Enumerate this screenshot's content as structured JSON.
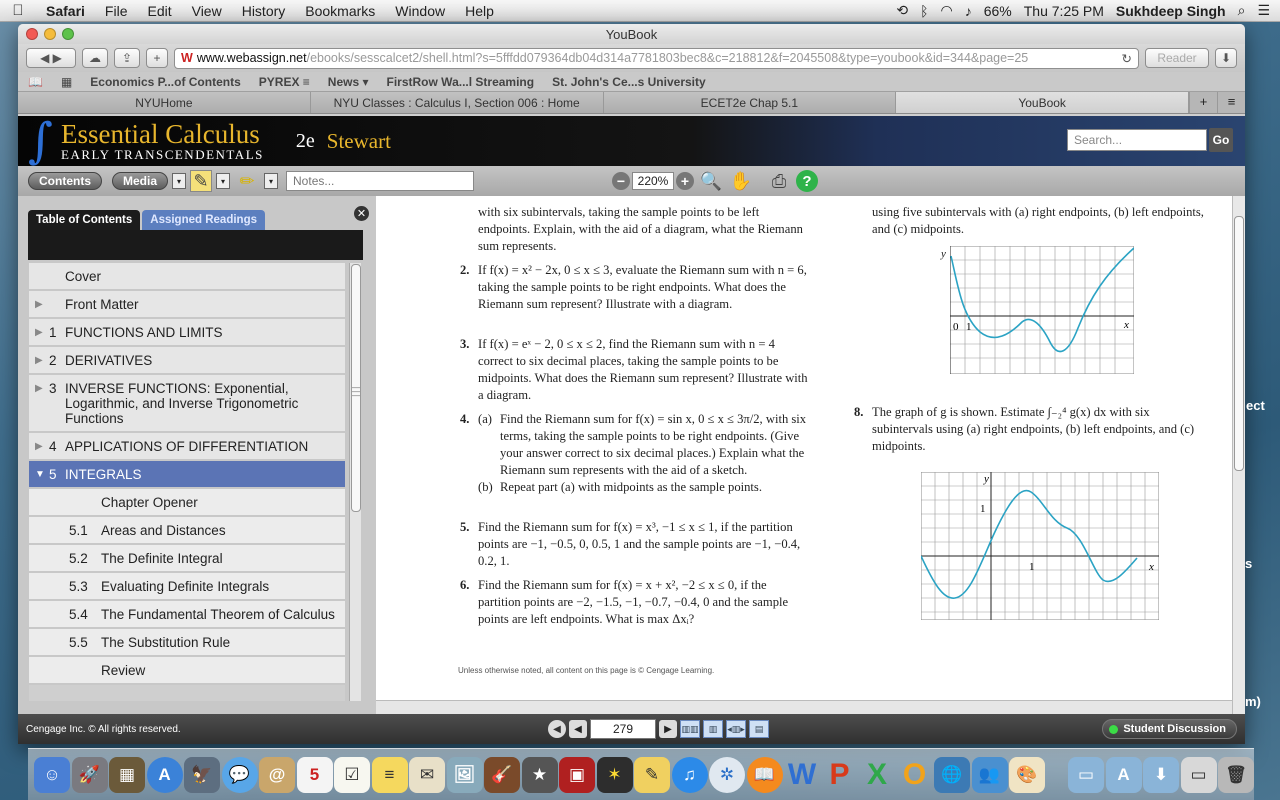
{
  "menubar": {
    "apple": "",
    "app": "Safari",
    "items": [
      "File",
      "Edit",
      "View",
      "History",
      "Bookmarks",
      "Window",
      "Help"
    ],
    "battery": "66%",
    "time": "Thu 7:25 PM",
    "user": "Sukhdeep Singh"
  },
  "window": {
    "title": "YouBook"
  },
  "browser": {
    "url_domain": "www.webassign.net",
    "url_path": "/ebooks/sesscalcet2/shell.html?s=5fffdd079364db04d314a7781803bec8&c=218812&f=2045508&type=youbook&id=344&page=25",
    "reader": "Reader",
    "favorites": [
      "Economics P...of Contents",
      "PYREX ≡",
      "News ▾",
      "FirstRow Wa...l Streaming",
      "St. John's Ce...s University"
    ],
    "tabs": [
      {
        "label": "NYUHome"
      },
      {
        "label": "NYU Classes : Calculus I, Section 006 : Home"
      },
      {
        "label": "ECET2e Chap 5.1"
      },
      {
        "label": "YouBook"
      }
    ]
  },
  "header": {
    "brand_title": "Essential Calculus",
    "brand_sub": "EARLY TRANSCENDENTALS",
    "edition": "2e",
    "author": "Stewart",
    "search_placeholder": "Search...",
    "go": "Go"
  },
  "toolbar": {
    "contents": "Contents",
    "media": "Media",
    "notes_placeholder": "Notes...",
    "zoom": "220%"
  },
  "sidebar": {
    "tab1": "Table of Contents",
    "tab2": "Assigned Readings",
    "items": [
      {
        "arrow": "",
        "num": "",
        "label": "Cover",
        "cls": ""
      },
      {
        "arrow": "▶",
        "num": "",
        "label": "Front Matter",
        "cls": ""
      },
      {
        "arrow": "▶",
        "num": "1",
        "label": "FUNCTIONS AND LIMITS",
        "cls": ""
      },
      {
        "arrow": "▶",
        "num": "2",
        "label": "DERIVATIVES",
        "cls": ""
      },
      {
        "arrow": "▶",
        "num": "3",
        "label": "INVERSE FUNCTIONS: Exponential, Logarithmic, and Inverse Trigonometric Functions",
        "cls": ""
      },
      {
        "arrow": "▶",
        "num": "4",
        "label": "APPLICATIONS OF DIFFERENTIATION",
        "cls": ""
      },
      {
        "arrow": "▼",
        "num": "5",
        "label": "INTEGRALS",
        "cls": "sel"
      },
      {
        "arrow": "",
        "num": "",
        "label": "Chapter Opener",
        "cls": "sub"
      },
      {
        "arrow": "",
        "num": "5.1",
        "label": "Areas and Distances",
        "cls": "sub"
      },
      {
        "arrow": "",
        "num": "5.2",
        "label": "The Definite Integral",
        "cls": "sub"
      },
      {
        "arrow": "",
        "num": "5.3",
        "label": "Evaluating Definite Integrals",
        "cls": "sub"
      },
      {
        "arrow": "",
        "num": "5.4",
        "label": "The Fundamental Theorem of Calculus",
        "cls": "sub"
      },
      {
        "arrow": "",
        "num": "5.5",
        "label": "The Substitution Rule",
        "cls": "sub"
      },
      {
        "arrow": "",
        "num": "",
        "label": "Review",
        "cls": "sub"
      }
    ]
  },
  "page": {
    "p1_tail": "with six subintervals, taking the sample points to be left endpoints. Explain, with the aid of a diagram, what the Riemann sum represents.",
    "p2_num": "2.",
    "p2": "If f(x) = x² − 2x, 0 ≤ x ≤ 3, evaluate the Riemann sum with n = 6, taking the sample points to be right endpoints. What does the Riemann sum represent? Illustrate with a diagram.",
    "p3_num": "3.",
    "p3": "If f(x) = eˣ − 2, 0 ≤ x ≤ 2, find the Riemann sum with n = 4 correct to six decimal places, taking the sample points to be midpoints. What does the Riemann sum represent? Illustrate with a diagram.",
    "p4_num": "4.",
    "p4a_lab": "(a)",
    "p4a": "Find the Riemann sum for f(x) = sin x, 0 ≤ x ≤ 3π/2, with six terms, taking the sample points to be right endpoints. (Give your answer correct to six decimal places.) Explain what the Riemann sum represents with the aid of a sketch.",
    "p4b_lab": "(b)",
    "p4b": "Repeat part (a) with midpoints as the sample points.",
    "p5_num": "5.",
    "p5": "Find the Riemann sum for f(x) = x³, −1 ≤ x ≤ 1, if the partition points are −1, −0.5, 0, 0.5, 1 and the sample points are −1, −0.4, 0.2, 1.",
    "p6_num": "6.",
    "p6": "Find the Riemann sum for f(x) = x + x², −2 ≤ x ≤ 0, if the partition points are −2, −1.5, −1, −0.7, −0.4, 0 and the sample points are left endpoints. What is max Δxᵢ?",
    "p7_tail": "using five subintervals with (a) right endpoints, (b) left endpoints, and (c) midpoints.",
    "p8_num": "8.",
    "p8": "The graph of g is shown. Estimate ∫₋₂⁴ g(x) dx with six subintervals using (a) right endpoints, (b) left endpoints, and (c) midpoints.",
    "g1_y": "y",
    "g1_x": "x",
    "g1_0": "0",
    "g1_1x": "1",
    "g1_1y": "1",
    "g2_y": "y",
    "g2_x": "x",
    "g2_1x": "1",
    "g2_1y": "1",
    "footer": "Unless otherwise noted, all content on this page is © Cengage Learning."
  },
  "status": {
    "copyright": "Cengage Inc. © All rights reserved.",
    "page": "279",
    "discussion": "Student Discussion"
  },
  "background": {
    "right_text_1": "ect",
    "right_text_2": "s",
    "right_text_3": "m)"
  }
}
